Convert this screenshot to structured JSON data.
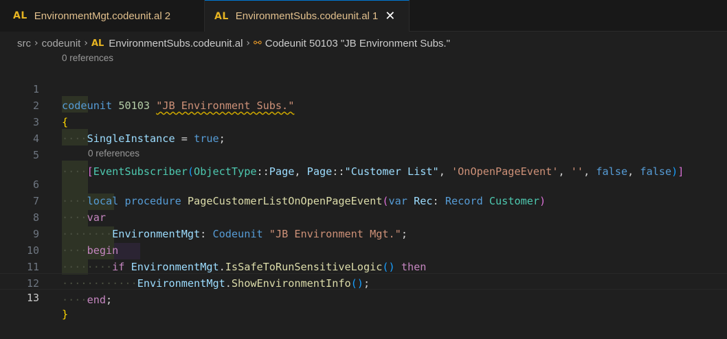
{
  "tabs": [
    {
      "lang_badge": "AL",
      "filename": "EnvironmentMgt.codeunit.al",
      "problems": "2"
    },
    {
      "lang_badge": "AL",
      "filename": "EnvironmentSubs.codeunit.al",
      "problems": "1",
      "close": "✕"
    }
  ],
  "breadcrumb": {
    "items": [
      "src",
      "codeunit"
    ],
    "file_badge": "AL",
    "file": "EnvironmentSubs.codeunit.al",
    "symbol": "Codeunit 50103 \"JB Environment Subs.\""
  },
  "codelens": [
    "0 references",
    "0 references"
  ],
  "line_numbers": [
    "1",
    "2",
    "3",
    "4",
    "5",
    "6",
    "7",
    "8",
    "9",
    "10",
    "11",
    "12",
    "13"
  ],
  "code": {
    "l1": [
      "codeunit",
      "50103",
      "\"JB Environment Subs.\""
    ],
    "l2": [
      "{"
    ],
    "l3": [
      "SingleInstance",
      "=",
      "true",
      ";"
    ],
    "l5": [
      "[",
      "EventSubscriber",
      "(",
      "ObjectType",
      "::",
      "Page",
      ",",
      "Page",
      "::",
      "\"Customer List\"",
      ",",
      "'OnOpenPageEvent'",
      ",",
      "''",
      ",",
      "false",
      ",",
      "false",
      ")",
      "]"
    ],
    "l6": [
      "local",
      "procedure",
      "PageCustomerListOnOpenPageEvent",
      "(",
      "var",
      "Rec",
      ":",
      "Record",
      "Customer",
      ")"
    ],
    "l7": [
      "var"
    ],
    "l8": [
      "EnvironmentMgt",
      ":",
      "Codeunit",
      "\"JB Environment Mgt.\"",
      ";"
    ],
    "l9": [
      "begin"
    ],
    "l10": [
      "if",
      "EnvironmentMgt",
      ".",
      "IsSafeToRunSensitiveLogic",
      "()",
      "then"
    ],
    "l11": [
      "EnvironmentMgt",
      ".",
      "ShowEnvironmentInfo",
      "()",
      ";"
    ],
    "l12": [
      "end",
      ";"
    ],
    "l13": [
      "}"
    ]
  },
  "colors": {
    "keyword": "#569cd6",
    "control": "#c586c0",
    "string": "#ce9178",
    "number": "#b5cea8",
    "function": "#dcdcaa",
    "variable": "#9cdcfe",
    "type": "#4ec9b0",
    "bracket1": "#ffd700",
    "bracket2": "#da70d6",
    "bracket3": "#179fff",
    "badge": "#e6b422",
    "modified": "#e2c08d"
  }
}
